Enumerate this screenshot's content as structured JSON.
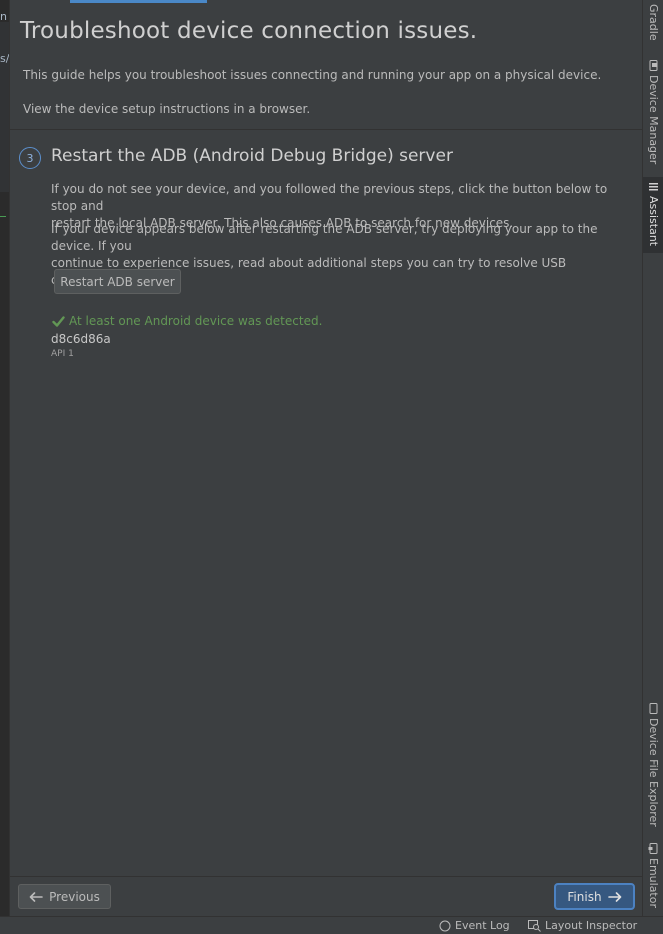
{
  "editor_fragments": [
    "n",
    "s/"
  ],
  "assistant": {
    "title": "Troubleshoot device connection issues.",
    "intro_line1": "This guide helps you troubleshoot issues connecting and running your app on a physical device.",
    "intro_line2": "View the device setup instructions in a browser.",
    "step": {
      "number": "3",
      "title": "Restart the ADB (Android Debug Bridge) server",
      "para1_line1": "If you do not see your device, and you followed the previous steps, click the button below to stop and",
      "para1_line2": "restart the local ADB server. This also causes ADB to search for new devices.",
      "para2_line1": "If your device appears below after restarting the ADB server, try deploying your app to the device. If you",
      "para2_line2": "continue to experience issues, read about additional steps you can try to resolve USB connection issues.",
      "restart_button": "Restart ADB server",
      "status_message": "At least one Android device was detected.",
      "device_id": "d8c6d86a",
      "device_api": "API 1"
    },
    "previous_button": "Previous",
    "finish_button": "Finish"
  },
  "right_tabs": {
    "gradle": "Gradle",
    "device_manager": "Device Manager",
    "assistant": "Assistant",
    "device_file_explorer": "Device File Explorer",
    "emulator": "Emulator"
  },
  "status_bar": {
    "event_log": "Event Log",
    "layout_inspector": "Layout Inspector"
  },
  "colors": {
    "background": "#3c3f41",
    "success": "#629755",
    "accent": "#4a88c7",
    "primary_button": "#365880"
  }
}
